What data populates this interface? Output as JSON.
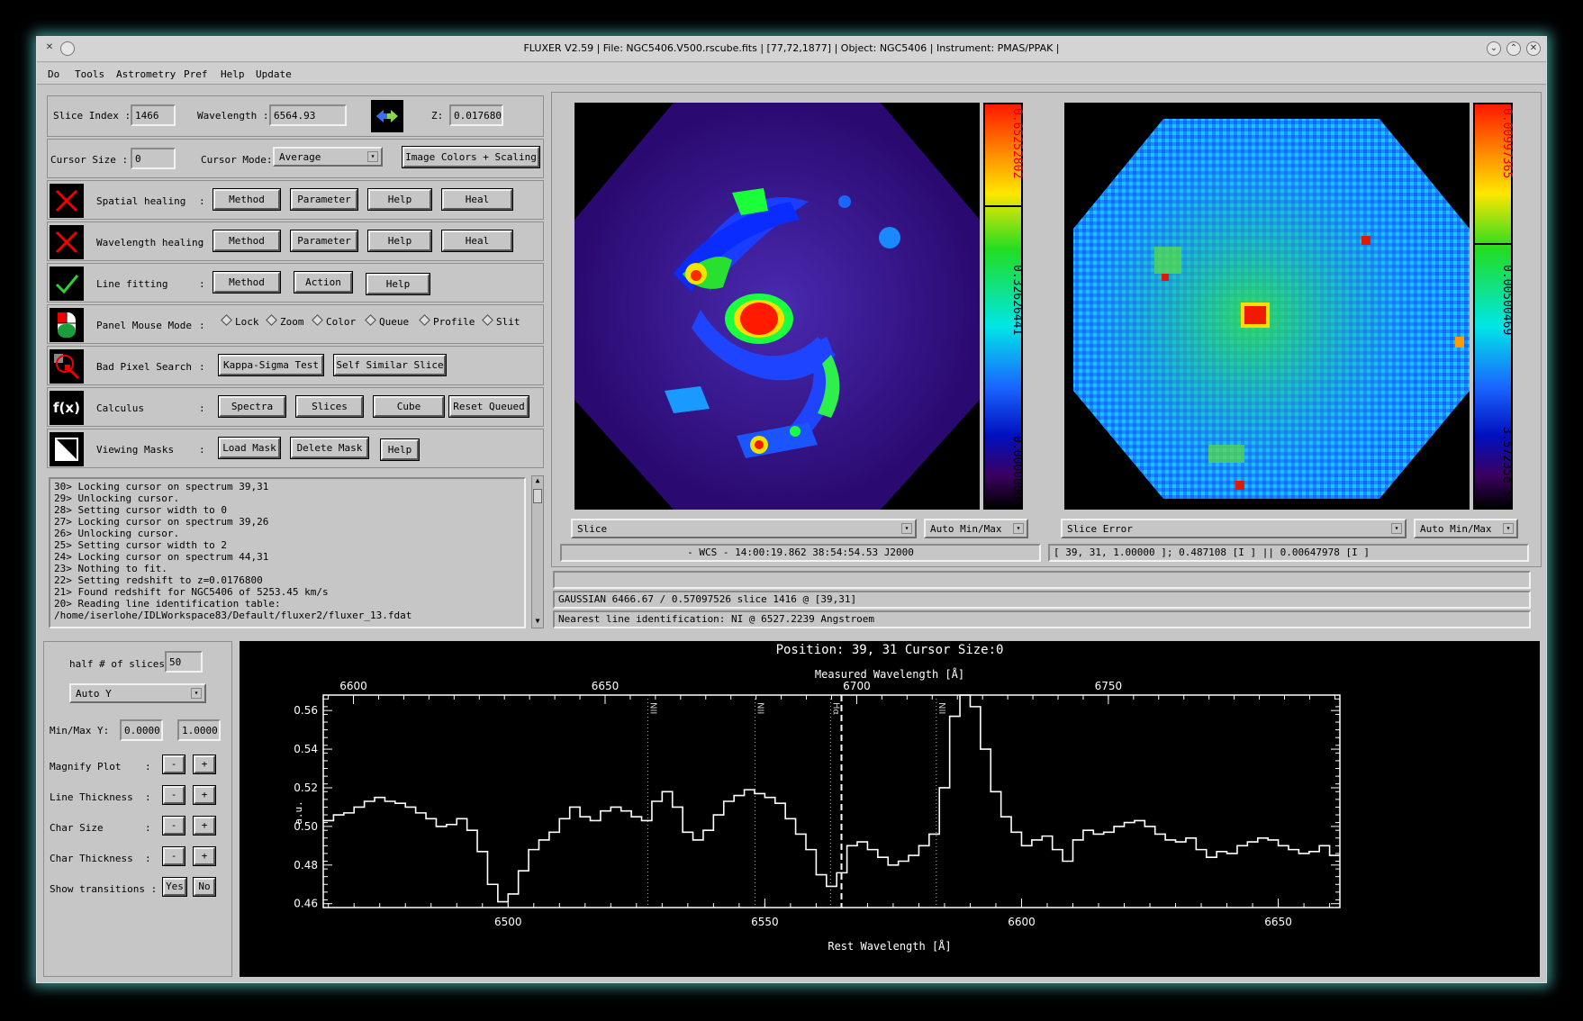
{
  "window": {
    "title": "FLUXER V2.59          |  File: NGC5406.V500.rscube.fits   |  [77,72,1877]  |  Object: NGC5406  |  Instrument: PMAS/PPAK  |"
  },
  "menu": [
    "Do",
    "Tools",
    "Astrometry",
    "Pref",
    "Help",
    "Update"
  ],
  "controls": {
    "slice_index_label": "Slice Index :",
    "slice_index": "1466",
    "wavelength_label": "Wavelength :",
    "wavelength": "6564.93",
    "z_label": "Z:",
    "z": "0.017680",
    "cursor_size_label": "Cursor Size :",
    "cursor_size": "0",
    "cursor_mode_label": "Cursor Mode:",
    "cursor_mode": "Average",
    "image_colors_button": "Image Colors + Scaling"
  },
  "rows": [
    {
      "label": "Spatial healing",
      "buttons": [
        "Method",
        "Parameter",
        "Help",
        "Heal"
      ]
    },
    {
      "label": "Wavelength healing",
      "buttons": [
        "Method",
        "Parameter",
        "Help",
        "Heal"
      ]
    },
    {
      "label": "Line fitting",
      "buttons": [
        "Method",
        "Action",
        "Help"
      ]
    },
    {
      "label": "Panel Mouse Mode",
      "radios": [
        "Lock",
        "Zoom",
        "Color",
        "Queue",
        "Profile",
        "Slit"
      ]
    },
    {
      "label": "Bad Pixel Search",
      "buttons": [
        "Kappa-Sigma Test",
        "Self Similar Slice"
      ]
    },
    {
      "label": "Calculus",
      "buttons": [
        "Spectra",
        "Slices",
        "Cube",
        "Reset Queued"
      ]
    },
    {
      "label": "Viewing Masks",
      "buttons": [
        "Load Mask",
        "Delete Mask",
        "Help"
      ]
    }
  ],
  "colon": ":",
  "fx_text": "f(x)",
  "log": [
    "30> Locking cursor on spectrum 39,31",
    "29> Unlocking cursor.",
    "28> Setting cursor width to 0",
    "27> Locking cursor on spectrum 39,26",
    "26> Unlocking cursor.",
    "25> Setting cursor width to 2",
    "24> Locking cursor on spectrum 44,31",
    "23> Nothing to fit.",
    "22> Setting redshift to z=0.0176800",
    "21> Found redshift for NGC5406 of 5253.45 km/s",
    "20> Reading line identification table:",
    "/home/iserlohe/IDLWorkspace83/Default/fluxer2/fluxer_13.fdat"
  ],
  "image_left": {
    "colorbar_top": "0.65252802",
    "colorbar_mid": "0.32626441",
    "colorbar_bot": "0.0000000",
    "selector": "Slice",
    "scaling": "Auto Min/Max",
    "coord": "- WCS -    14:00:19.862   38:54:54.53  J2000"
  },
  "image_right": {
    "colorbar_top": "0.00997365",
    "colorbar_mid": "0.00500469",
    "colorbar_bot": "3.57235e-5",
    "selector": "Slice Error",
    "scaling": "Auto Min/Max",
    "coord": "[ 39, 31, 1.00000 ];        0.487108     [I    ]   ||  0.00647978   [I    ]"
  },
  "status": {
    "line1": "",
    "line2": "GAUSSIAN  6466.67 / 0.57097526 slice 1416 @ [39,31]",
    "line3": "Nearest line identification: NI @ 6527.2239 Angstroem"
  },
  "plot_controls": {
    "half_slices_label": "half # of slices",
    "half_slices": "50",
    "y_mode": "Auto Y",
    "minmax_label": "Min/Max Y:",
    "ymin": "0.0000",
    "ymax": "1.0000",
    "magnify": "Magnify Plot",
    "line_thickness": "Line Thickness",
    "char_size": "Char Size",
    "char_thickness": "Char Thickness",
    "minus": "-",
    "plus": "+",
    "show_transitions": "Show transitions :",
    "yes": "Yes",
    "no": "No"
  },
  "chart_data": {
    "type": "line",
    "title": "Position: 39, 31   Cursor Size:0",
    "xlabel": "Rest Wavelength [Å]",
    "x2label": "Measured Wavelength [Å]",
    "ylabel": "a.u.",
    "xlim": [
      6464,
      6662
    ],
    "ylim": [
      0.458,
      0.568
    ],
    "x_ticks": [
      "6500",
      "6550",
      "6600",
      "6650"
    ],
    "x_tick_values": [
      6500,
      6550,
      6600,
      6650
    ],
    "x2_ticks": [
      "6600",
      "6650",
      "6700",
      "6750"
    ],
    "x2_tick_values": [
      6600,
      6650,
      6700,
      6750
    ],
    "y_ticks": [
      "0.46",
      "0.48",
      "0.50",
      "0.52",
      "0.54",
      "0.56"
    ],
    "y_tick_values": [
      0.46,
      0.48,
      0.5,
      0.52,
      0.54,
      0.56
    ],
    "lines": [
      {
        "label": "NII",
        "x": 6527.2
      },
      {
        "label": "NII",
        "x": 6548.1
      },
      {
        "label": "Hα",
        "x": 6562.8
      },
      {
        "label": "NII",
        "x": 6583.4
      }
    ],
    "dashed_x": 6564.93,
    "x": [
      6465,
      6467,
      6469,
      6471,
      6473,
      6475,
      6477,
      6479,
      6481,
      6483,
      6485,
      6487,
      6489,
      6491,
      6493,
      6495,
      6497,
      6499,
      6501,
      6503,
      6505,
      6507,
      6509,
      6511,
      6513,
      6515,
      6517,
      6519,
      6521,
      6523,
      6525,
      6527,
      6529,
      6531,
      6533,
      6535,
      6537,
      6539,
      6541,
      6543,
      6545,
      6547,
      6549,
      6551,
      6553,
      6555,
      6557,
      6559,
      6561,
      6563,
      6565,
      6567,
      6569,
      6571,
      6573,
      6575,
      6577,
      6579,
      6581,
      6583,
      6585,
      6587,
      6589,
      6591,
      6593,
      6595,
      6597,
      6599,
      6601,
      6603,
      6605,
      6607,
      6609,
      6611,
      6613,
      6615,
      6617,
      6619,
      6621,
      6623,
      6625,
      6627,
      6629,
      6631,
      6633,
      6635,
      6637,
      6639,
      6641,
      6643,
      6645,
      6647,
      6649,
      6651,
      6653,
      6655,
      6657,
      6659,
      6661
    ],
    "y": [
      0.503,
      0.506,
      0.507,
      0.51,
      0.513,
      0.515,
      0.513,
      0.512,
      0.51,
      0.507,
      0.504,
      0.5,
      0.501,
      0.504,
      0.498,
      0.487,
      0.47,
      0.461,
      0.465,
      0.477,
      0.488,
      0.493,
      0.497,
      0.504,
      0.51,
      0.505,
      0.503,
      0.508,
      0.51,
      0.508,
      0.505,
      0.503,
      0.513,
      0.518,
      0.51,
      0.497,
      0.493,
      0.498,
      0.506,
      0.513,
      0.516,
      0.519,
      0.517,
      0.515,
      0.512,
      0.504,
      0.496,
      0.488,
      0.475,
      0.469,
      0.476,
      0.49,
      0.492,
      0.488,
      0.484,
      0.48,
      0.482,
      0.485,
      0.49,
      0.496,
      0.52,
      0.557,
      0.568,
      0.562,
      0.54,
      0.518,
      0.505,
      0.497,
      0.49,
      0.493,
      0.495,
      0.488,
      0.482,
      0.493,
      0.498,
      0.496,
      0.497,
      0.5,
      0.502,
      0.503,
      0.5,
      0.496,
      0.493,
      0.492,
      0.494,
      0.488,
      0.484,
      0.487,
      0.486,
      0.49,
      0.492,
      0.494,
      0.493,
      0.49,
      0.488,
      0.486,
      0.487,
      0.49,
      0.485
    ]
  }
}
